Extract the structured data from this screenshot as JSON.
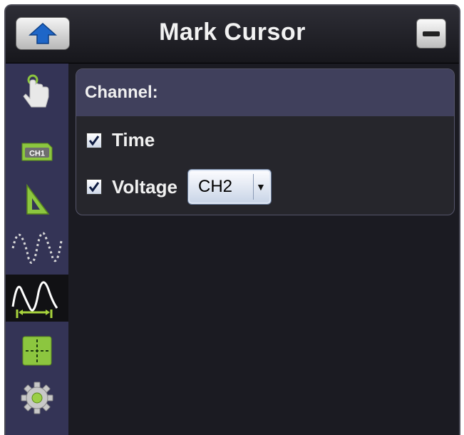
{
  "window": {
    "title": "Mark Cursor"
  },
  "toolbar": {
    "up_icon": "up-arrow-icon",
    "minimize_icon": "minimize-icon"
  },
  "sidebar": {
    "items": [
      {
        "icon": "touch-hand-icon",
        "active": false
      },
      {
        "icon": "channel-ch1-icon",
        "active": false
      },
      {
        "icon": "math-triangle-icon",
        "active": false
      },
      {
        "icon": "waveform-icon",
        "active": false
      },
      {
        "icon": "waveform-cursor-icon",
        "active": true
      },
      {
        "icon": "crosshair-icon",
        "active": false
      },
      {
        "icon": "gear-icon",
        "active": false
      }
    ],
    "active_color": "#a8d43c"
  },
  "panel": {
    "header": "Channel:",
    "time_label": "Time",
    "time_checked": true,
    "voltage_label": "Voltage",
    "voltage_checked": true,
    "voltage_channel": "CH2"
  },
  "colors": {
    "background": "#1b1b22",
    "sidebar": "#343456",
    "panel_header": "#40405c",
    "accent_green": "#8cc63f"
  }
}
